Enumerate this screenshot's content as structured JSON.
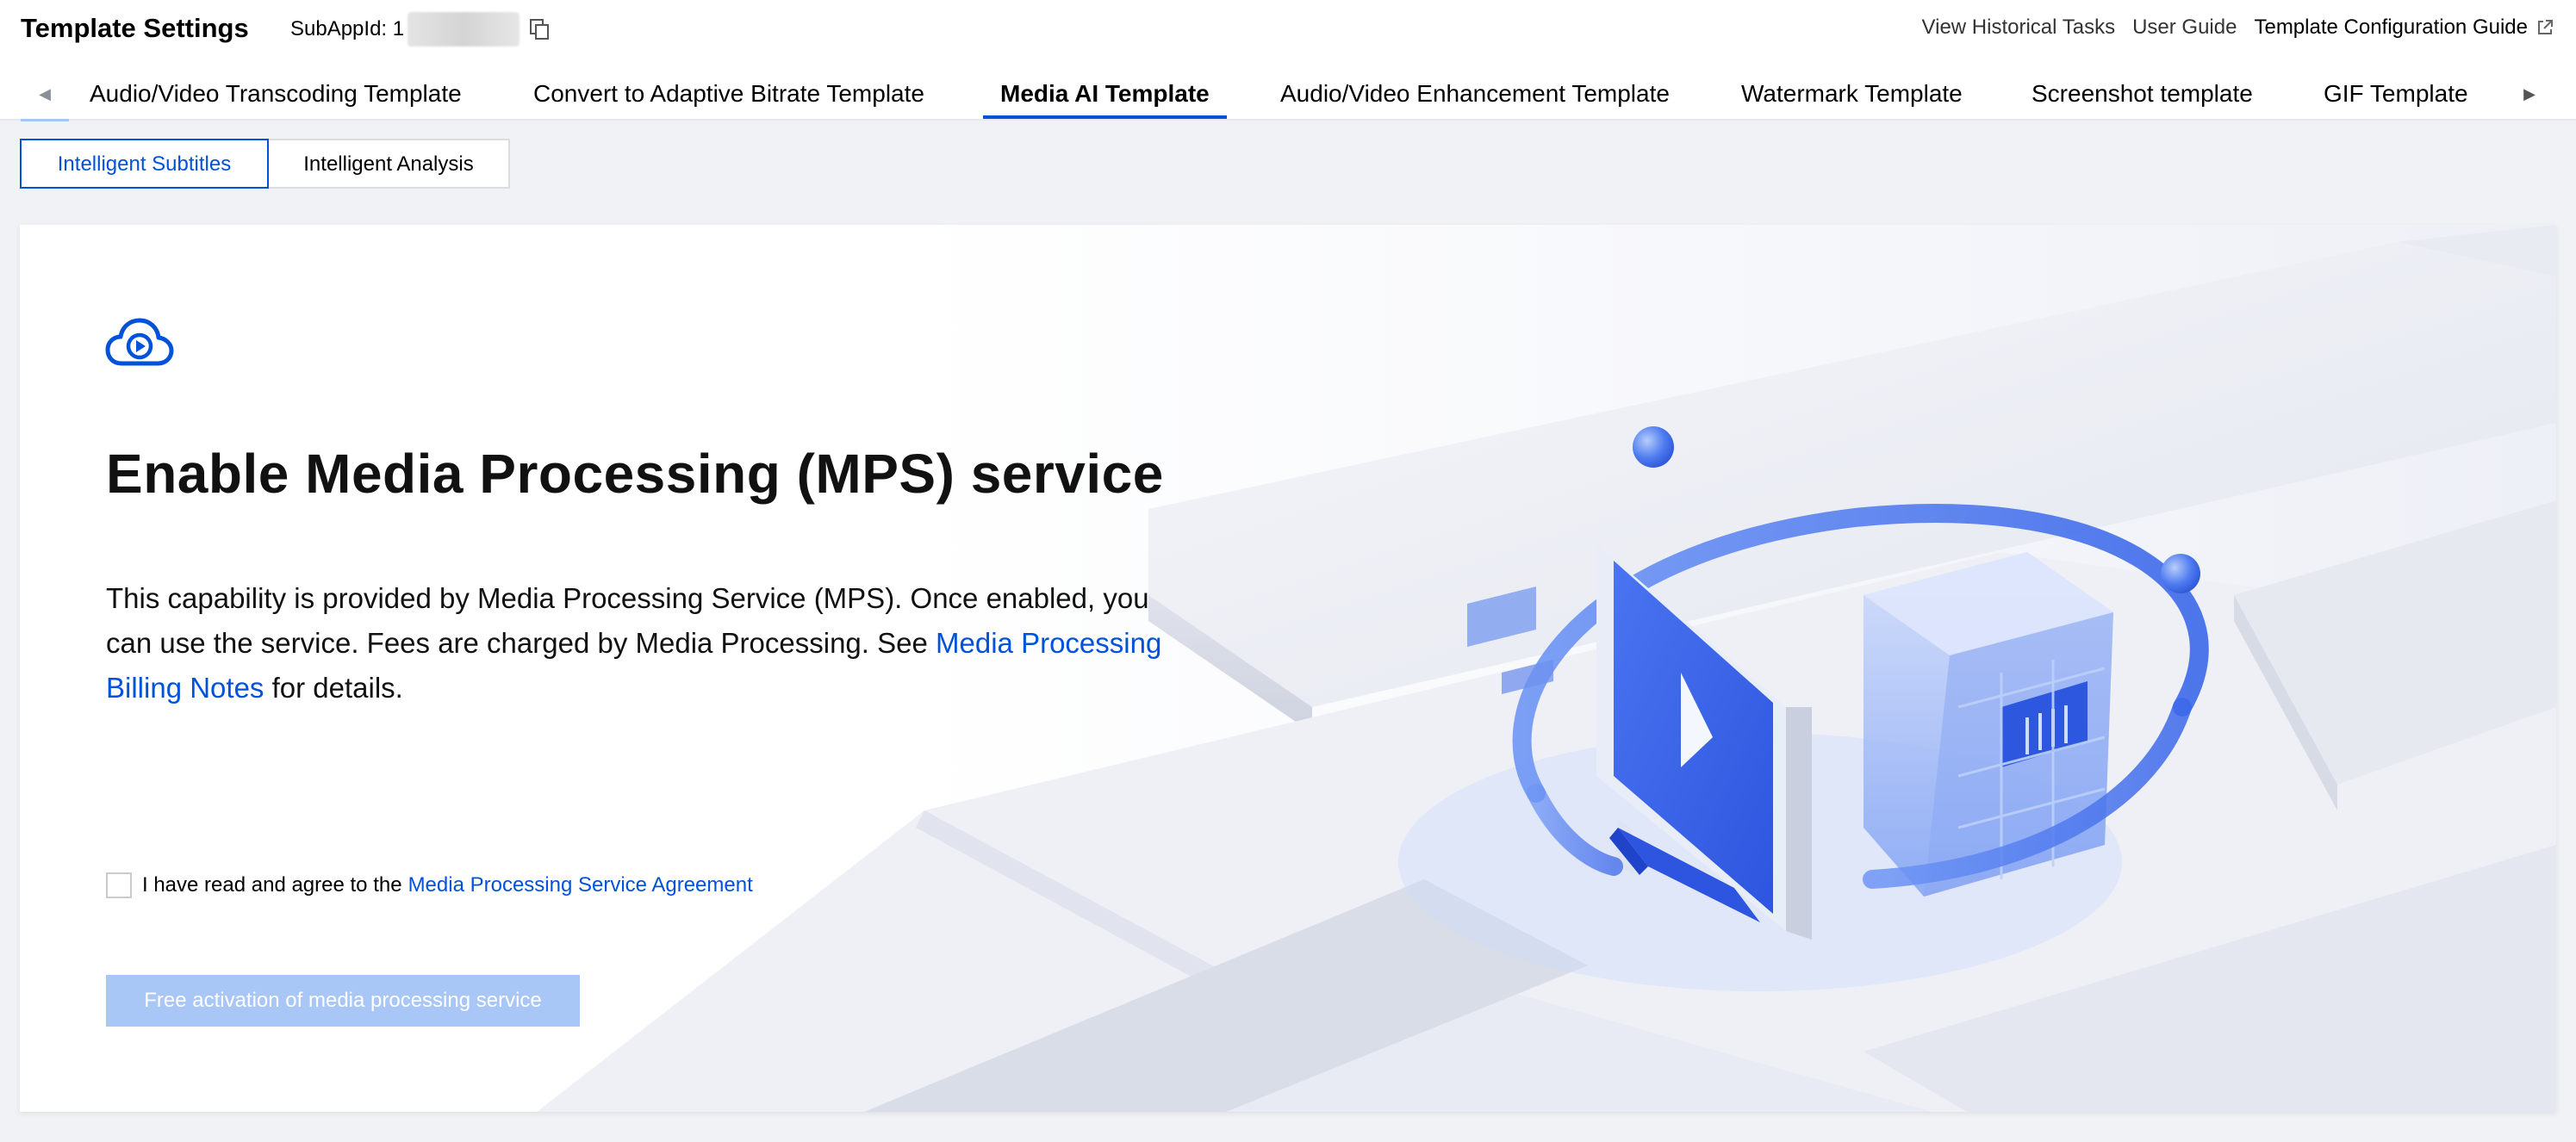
{
  "header": {
    "title": "Template Settings",
    "subappid_label": "SubAppId: 1",
    "links": {
      "historical_tasks": "View Historical Tasks",
      "user_guide": "User Guide",
      "config_guide": "Template Configuration Guide"
    }
  },
  "tabs": [
    {
      "label": "Audio/Video Transcoding Template"
    },
    {
      "label": "Convert to Adaptive Bitrate Template"
    },
    {
      "label": "Media AI Template",
      "active": true
    },
    {
      "label": "Audio/Video Enhancement Template"
    },
    {
      "label": "Watermark Template"
    },
    {
      "label": "Screenshot template"
    },
    {
      "label": "GIF Template"
    }
  ],
  "subtabs": [
    {
      "label": "Intelligent Subtitles",
      "active": true
    },
    {
      "label": "Intelligent Analysis"
    }
  ],
  "main": {
    "headline": "Enable Media Processing (MPS) service",
    "description_prefix": "This capability is provided by Media Processing Service (MPS). Once enabled, you can use the service. Fees are charged by Media Processing. See ",
    "description_link": "Media Processing Billing Notes",
    "description_suffix": " for details.",
    "agreement_prefix": "I have read and agree to the",
    "agreement_link": "Media Processing Service Agreement",
    "agreement_checked": false,
    "cta_label": "Free activation of media processing service"
  },
  "icons": {
    "copy": "copy-icon",
    "external": "external-link-icon",
    "cloud": "cloud-play-icon",
    "tab_left": "caret-left-icon",
    "tab_right": "caret-right-icon"
  },
  "colors": {
    "brand": "#0052d9",
    "cta_disabled": "#a8c6f6",
    "background": "#f1f2f5"
  }
}
